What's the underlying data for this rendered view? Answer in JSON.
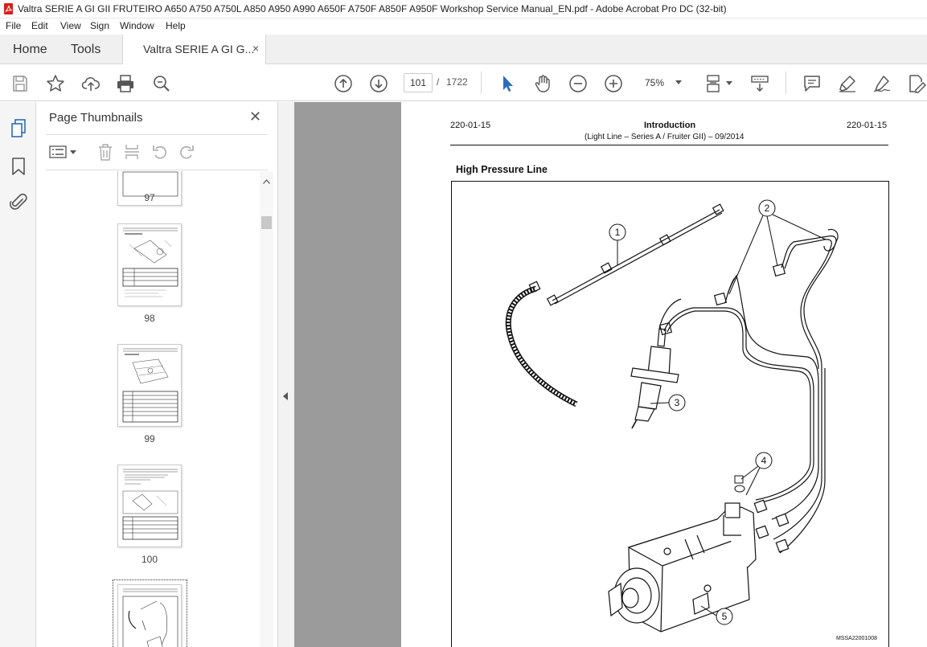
{
  "window": {
    "title": "Valtra SERIE A GI GII FRUTEIRO A650 A750  A750L A850 A950 A990 A650F A750F A850F A950F Workshop Service Manual_EN.pdf - Adobe Acrobat Pro DC (32-bit)"
  },
  "menu": [
    "File",
    "Edit",
    "View",
    "Sign",
    "Window",
    "Help"
  ],
  "tabs": {
    "home": "Home",
    "tools": "Tools",
    "document": "Valtra SERIE A GI G...",
    "close": "×"
  },
  "toolbar": {
    "current_page": "101",
    "page_separator": "/",
    "total_pages": "1722",
    "zoom": "75%",
    "icons": [
      "save-icon",
      "bookmark-star-icon",
      "upload-cloud-icon",
      "print-icon",
      "zoom-search-icon",
      "page-up-icon",
      "page-down-icon",
      "select-cursor-icon",
      "hand-icon",
      "zoom-out-icon",
      "zoom-in-icon",
      "page-fit-icon",
      "scroll-mode-icon",
      "comment-icon",
      "highlight-icon",
      "sign-icon",
      "edit-pdf-icon"
    ]
  },
  "thumbnails_panel": {
    "title": "Page Thumbnails",
    "close": "✕",
    "pages": [
      {
        "label": "97"
      },
      {
        "label": "98"
      },
      {
        "label": "99"
      },
      {
        "label": "100"
      },
      {
        "label": ""
      }
    ]
  },
  "document_page": {
    "header_left": "220-01-15",
    "header_center": "Introduction",
    "header_subtitle": "(Light Line – Series A / Fruiter GII) – 09/2014",
    "header_right": "220-01-15",
    "section_title": "High Pressure Line",
    "callouts": [
      "1",
      "2",
      "3",
      "4",
      "5"
    ],
    "figure_code": "MSSA22001008"
  },
  "colors": {
    "accent_blue": "#2a6ebb",
    "viewer_gray": "#9b9b9b",
    "pdf_red": "#d71f1f"
  }
}
